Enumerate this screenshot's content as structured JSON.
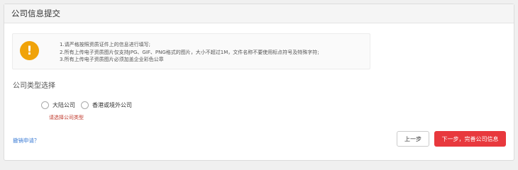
{
  "panel": {
    "title": "公司信息提交"
  },
  "notice": {
    "icon": "warning-icon",
    "icon_glyph": "!",
    "icon_color": "#f0a30a",
    "lines": [
      "1.请严格按照资质证件上的信息进行填写;",
      "2.所有上传电子资质图片仅支持JPG、GIF、PNG格式的图片，大小不超过1M，文件名称不要使用标点符号及特殊字符;",
      "3.所有上传电子资质图片必须加盖企业彩色公章"
    ]
  },
  "company_type": {
    "section_title": "公司类型选择",
    "options": [
      {
        "label": "大陆公司",
        "selected": false
      },
      {
        "label": "香港或境外公司",
        "selected": false
      }
    ],
    "error": "请选择公司类型",
    "error_color": "#c0392b"
  },
  "footer": {
    "revoke_link": "撤销申请？",
    "prev_button": "上一步",
    "next_button": "下一步，完善公司信息",
    "next_color": "#e8383d"
  }
}
